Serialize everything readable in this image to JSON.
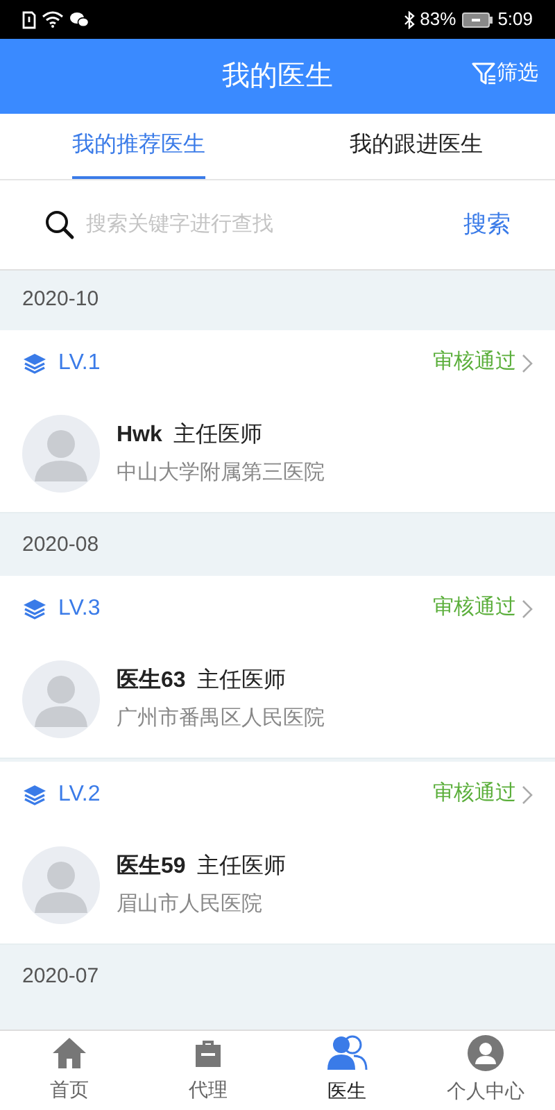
{
  "status_bar": {
    "battery": "83%",
    "time": "5:09"
  },
  "header": {
    "title": "我的医生",
    "filter": "筛选"
  },
  "tabs": [
    {
      "label": "我的推荐医生",
      "selected": true
    },
    {
      "label": "我的跟进医生",
      "selected": false
    }
  ],
  "search": {
    "placeholder": "搜索关键字进行查找",
    "button": "搜索"
  },
  "groups": [
    {
      "date": "2020-10",
      "doctors": [
        {
          "level": "LV.1",
          "status": "审核通过",
          "name": "Hwk",
          "title": "主任医师",
          "hospital": "中山大学附属第三医院"
        }
      ]
    },
    {
      "date": "2020-08",
      "doctors": [
        {
          "level": "LV.3",
          "status": "审核通过",
          "name": "医生63",
          "title": "主任医师",
          "hospital": "广州市番禺区人民医院"
        },
        {
          "level": "LV.2",
          "status": "审核通过",
          "name": "医生59",
          "title": "主任医师",
          "hospital": "眉山市人民医院"
        }
      ]
    },
    {
      "date": "2020-07"
    }
  ],
  "bottom_nav": [
    {
      "kind": "home",
      "label": "首页",
      "selected": false
    },
    {
      "kind": "agent",
      "label": "代理",
      "selected": false
    },
    {
      "kind": "doctor",
      "label": "医生",
      "selected": true
    },
    {
      "kind": "profile",
      "label": "个人中心",
      "selected": false
    }
  ]
}
